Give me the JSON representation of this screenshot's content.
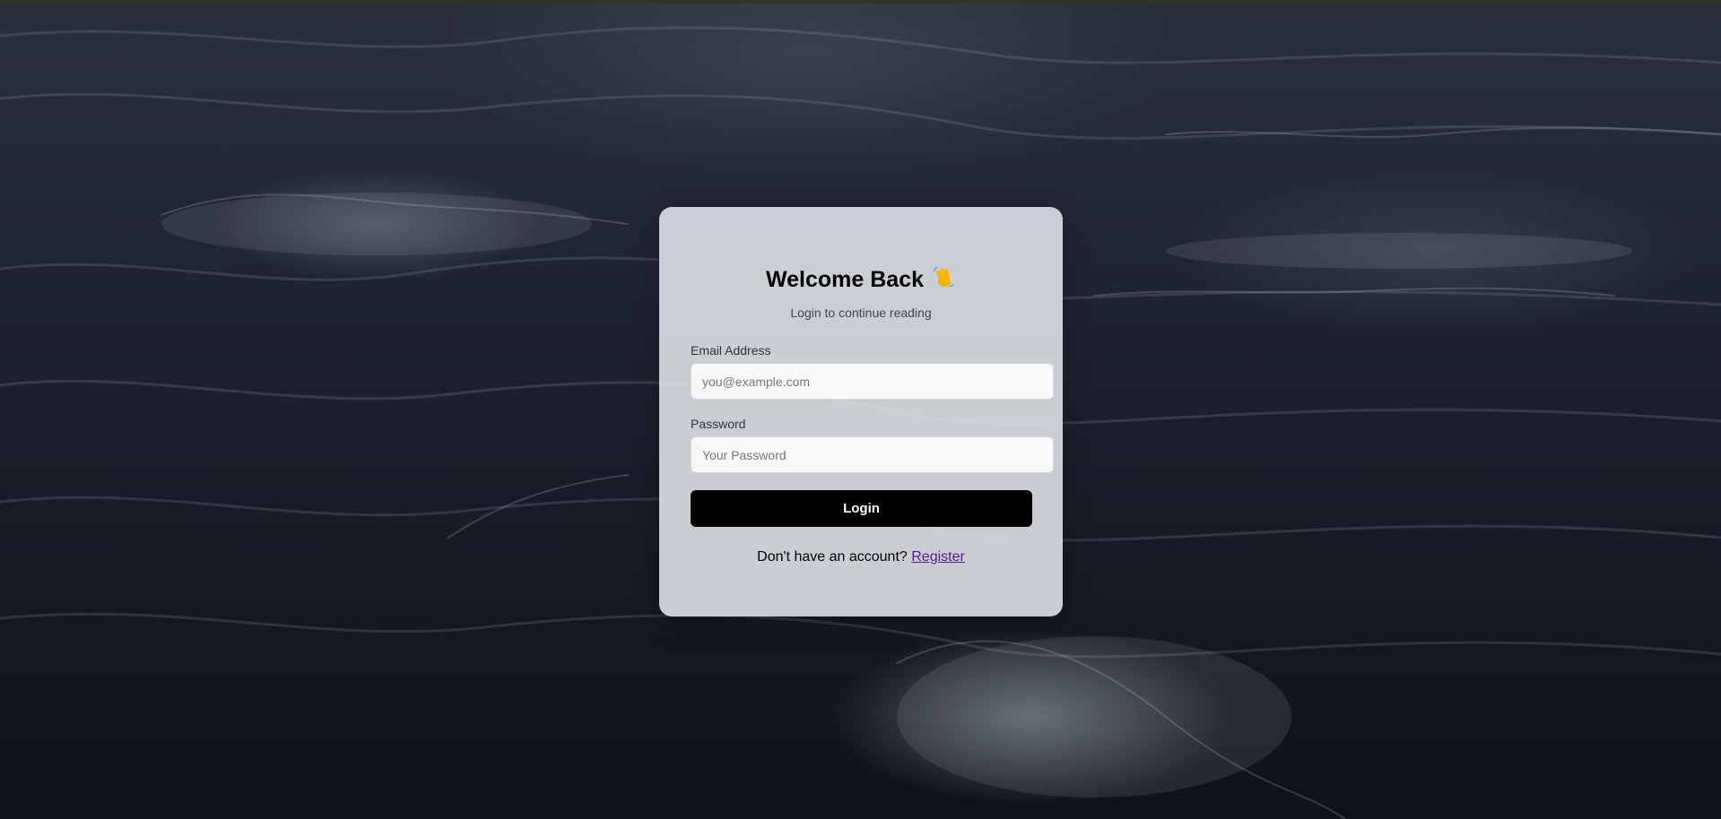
{
  "login": {
    "title": "Welcome Back",
    "title_icon": "waving-hand-icon",
    "subtitle": "Login to continue reading",
    "email_label": "Email Address",
    "email_placeholder": "you@example.com",
    "email_value": "",
    "password_label": "Password",
    "password_placeholder": "Your Password",
    "password_value": "",
    "login_button": "Login",
    "footer_text": "Don't have an account?",
    "register_link": "Register"
  },
  "colors": {
    "button_bg": "#000000",
    "link": "#551a8b",
    "card_bg": "#dee1e6"
  }
}
